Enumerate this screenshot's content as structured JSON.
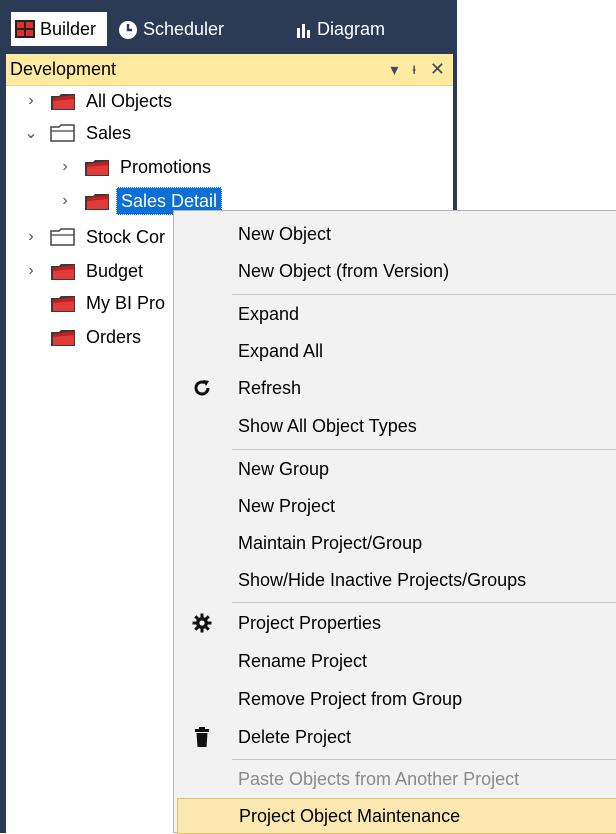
{
  "tabs": [
    {
      "label": "Builder",
      "icon": "builder-icon",
      "active": true
    },
    {
      "label": "Scheduler",
      "icon": "clock-icon",
      "active": false
    },
    {
      "label": "Diagram",
      "icon": "bar-chart-icon",
      "active": false
    }
  ],
  "pane": {
    "title": "Development",
    "controls": [
      "dropdown-arrow-icon",
      "pin-icon",
      "close-icon"
    ]
  },
  "tree": [
    {
      "label": "All Objects",
      "expanded": false,
      "hasChildren": true,
      "folder": "red"
    },
    {
      "label": "Sales",
      "expanded": true,
      "hasChildren": true,
      "folder": "plain"
    },
    {
      "label": "Promotions",
      "expanded": false,
      "hasChildren": true,
      "folder": "red"
    },
    {
      "label": "Sales Detail",
      "expanded": false,
      "hasChildren": true,
      "folder": "red",
      "selected": true
    },
    {
      "label": "Stock Cor",
      "expanded": false,
      "hasChildren": true,
      "folder": "plain"
    },
    {
      "label": "Budget",
      "expanded": false,
      "hasChildren": true,
      "folder": "red"
    },
    {
      "label": "My BI Pro",
      "expanded": false,
      "hasChildren": false,
      "folder": "red"
    },
    {
      "label": "Orders",
      "expanded": false,
      "hasChildren": false,
      "folder": "red"
    }
  ],
  "menu": [
    {
      "label": "New Object"
    },
    {
      "label": "New Object (from Version)"
    },
    {
      "label": "Expand"
    },
    {
      "label": "Expand All"
    },
    {
      "label": "Refresh",
      "icon": "refresh-icon"
    },
    {
      "label": "Show All Object Types"
    },
    {
      "label": "New Group"
    },
    {
      "label": "New Project"
    },
    {
      "label": "Maintain Project/Group"
    },
    {
      "label": "Show/Hide Inactive Projects/Groups"
    },
    {
      "label": "Project Properties",
      "icon": "gear-icon"
    },
    {
      "label": "Rename Project"
    },
    {
      "label": "Remove Project from Group"
    },
    {
      "label": "Delete Project",
      "icon": "trash-icon"
    },
    {
      "label": "Paste Objects from Another Project",
      "disabled": true
    },
    {
      "label": "Project Object Maintenance",
      "hover": true
    }
  ],
  "colors": {
    "panel": "#2b3a55",
    "header": "#ffeaa0",
    "selection": "#0b6fd6",
    "menu_hover": "#fbe8b0"
  }
}
